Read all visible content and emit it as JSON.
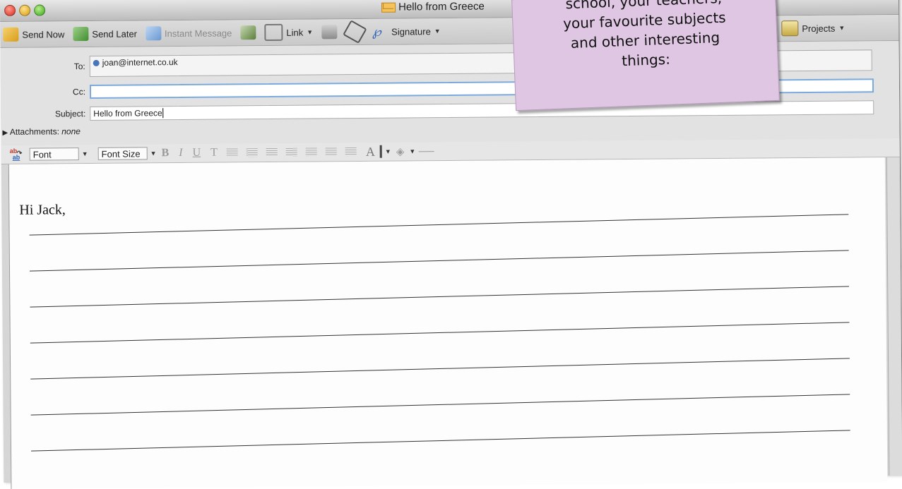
{
  "window": {
    "title": "Hello from Greece"
  },
  "toolbar": {
    "send_now": "Send Now",
    "send_later": "Send Later",
    "instant_message": "Instant Message",
    "link": "Link",
    "signature": "Signature",
    "projects": "Projects"
  },
  "headers": {
    "to_label": "To:",
    "to_value": "joan@internet.co.uk",
    "cc_label": "Cc:",
    "cc_value": "",
    "subject_label": "Subject:",
    "subject_value": "Hello from Greece",
    "attachments_label": "Attachments:",
    "attachments_value": "none"
  },
  "format_bar": {
    "font": "Font",
    "font_size": "Font Size",
    "bold": "B",
    "italic": "I",
    "underline": "U",
    "strike": "T"
  },
  "body": {
    "greeting": "Hi Jack,",
    "writing_lines": 7
  },
  "note": {
    "lines": [
      "school, your teachers,",
      "your favourite subjects",
      "and other interesting",
      "things:"
    ],
    "color": "#dfc6e3"
  }
}
